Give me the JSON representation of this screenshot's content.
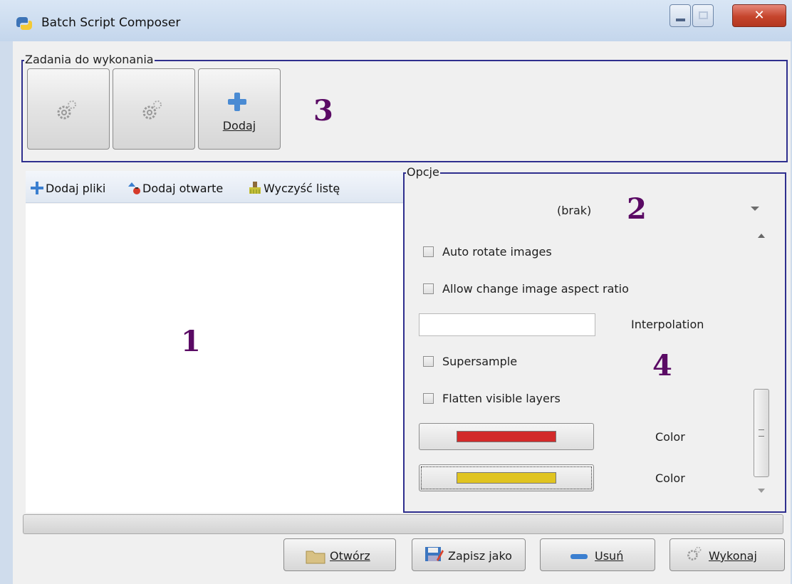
{
  "window": {
    "title": "Batch Script Composer"
  },
  "tasks_group": {
    "label": "Zadania do wykonania",
    "add_button_label": "Dodaj"
  },
  "files_toolbar": {
    "add_files": "Dodaj pliki",
    "add_open": "Dodaj otwarte",
    "clear_list": "Wyczyść listę"
  },
  "options": {
    "label": "Opcje",
    "combo_value": "(brak)",
    "checkboxes": [
      {
        "label": "Auto rotate images",
        "checked": false
      },
      {
        "label": "Allow change image aspect ratio",
        "checked": false
      },
      {
        "label": "Supersample",
        "checked": false
      },
      {
        "label": "Flatten visible layers",
        "checked": false
      }
    ],
    "interpolation_label": "Interpolation",
    "interpolation_value": "",
    "color_label_1": "Color",
    "color_1": "#d22a2a",
    "color_label_2": "Color",
    "color_2": "#e0c420"
  },
  "annotations": {
    "n1": "1",
    "n2": "2",
    "n3": "3",
    "n4": "4"
  },
  "bottom_buttons": {
    "open": "Otwórz",
    "save_as": "Zapisz jako",
    "remove": "Usuń",
    "run": "Wykonaj"
  },
  "colors": {
    "frame": "#2f2f8e",
    "annotation": "#5a0a64"
  }
}
